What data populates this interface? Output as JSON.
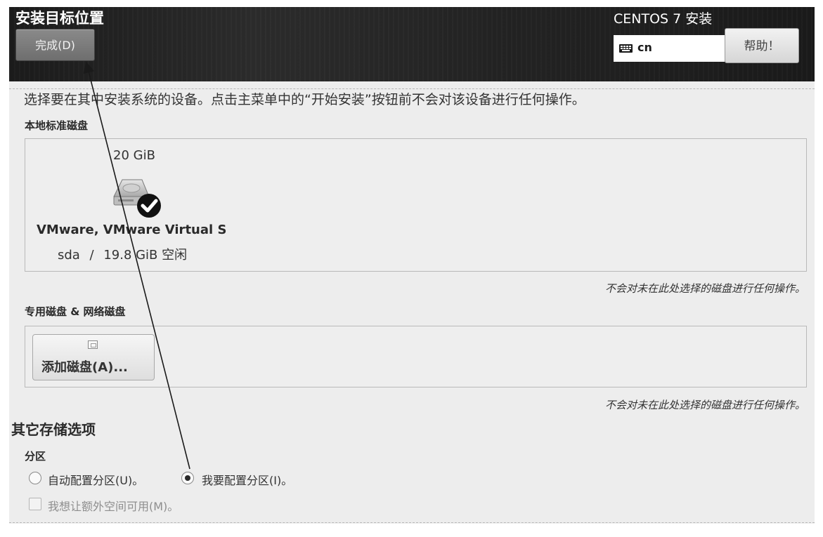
{
  "header": {
    "title": "安装目标位置",
    "done_label": "完成(D)",
    "product": "CENTOS 7 安装",
    "keyboard_layout": "cn",
    "help_label": "帮助！"
  },
  "main": {
    "intro": "选择要在其中安装系统的设备。点击主菜单中的“开始安装”按钮前不会对该设备进行任何操作。",
    "local_disks": {
      "heading": "本地标准磁盘",
      "disks": [
        {
          "size": "20 GiB",
          "name": "VMware, VMware Virtual S",
          "device": "sda",
          "separator": "/",
          "free": "19.8 GiB 空闲",
          "selected": true,
          "icon": "hard-disk-icon"
        }
      ],
      "note": "不会对未在此处选择的磁盘进行任何操作。"
    },
    "specialized_disks": {
      "heading": "专用磁盘 & 网络磁盘",
      "add_label": "添加磁盘(A)...",
      "note": "不会对未在此处选择的磁盘进行任何操作。"
    },
    "other_storage": {
      "heading": "其它存储选项",
      "partitioning": {
        "heading": "分区",
        "options": [
          {
            "label": "自动配置分区(U)。",
            "checked": false
          },
          {
            "label": "我要配置分区(I)。",
            "checked": true
          }
        ],
        "extra_space_label": "我想让额外空间可用(M)。",
        "extra_space_checked": false,
        "extra_space_enabled": false
      }
    }
  }
}
